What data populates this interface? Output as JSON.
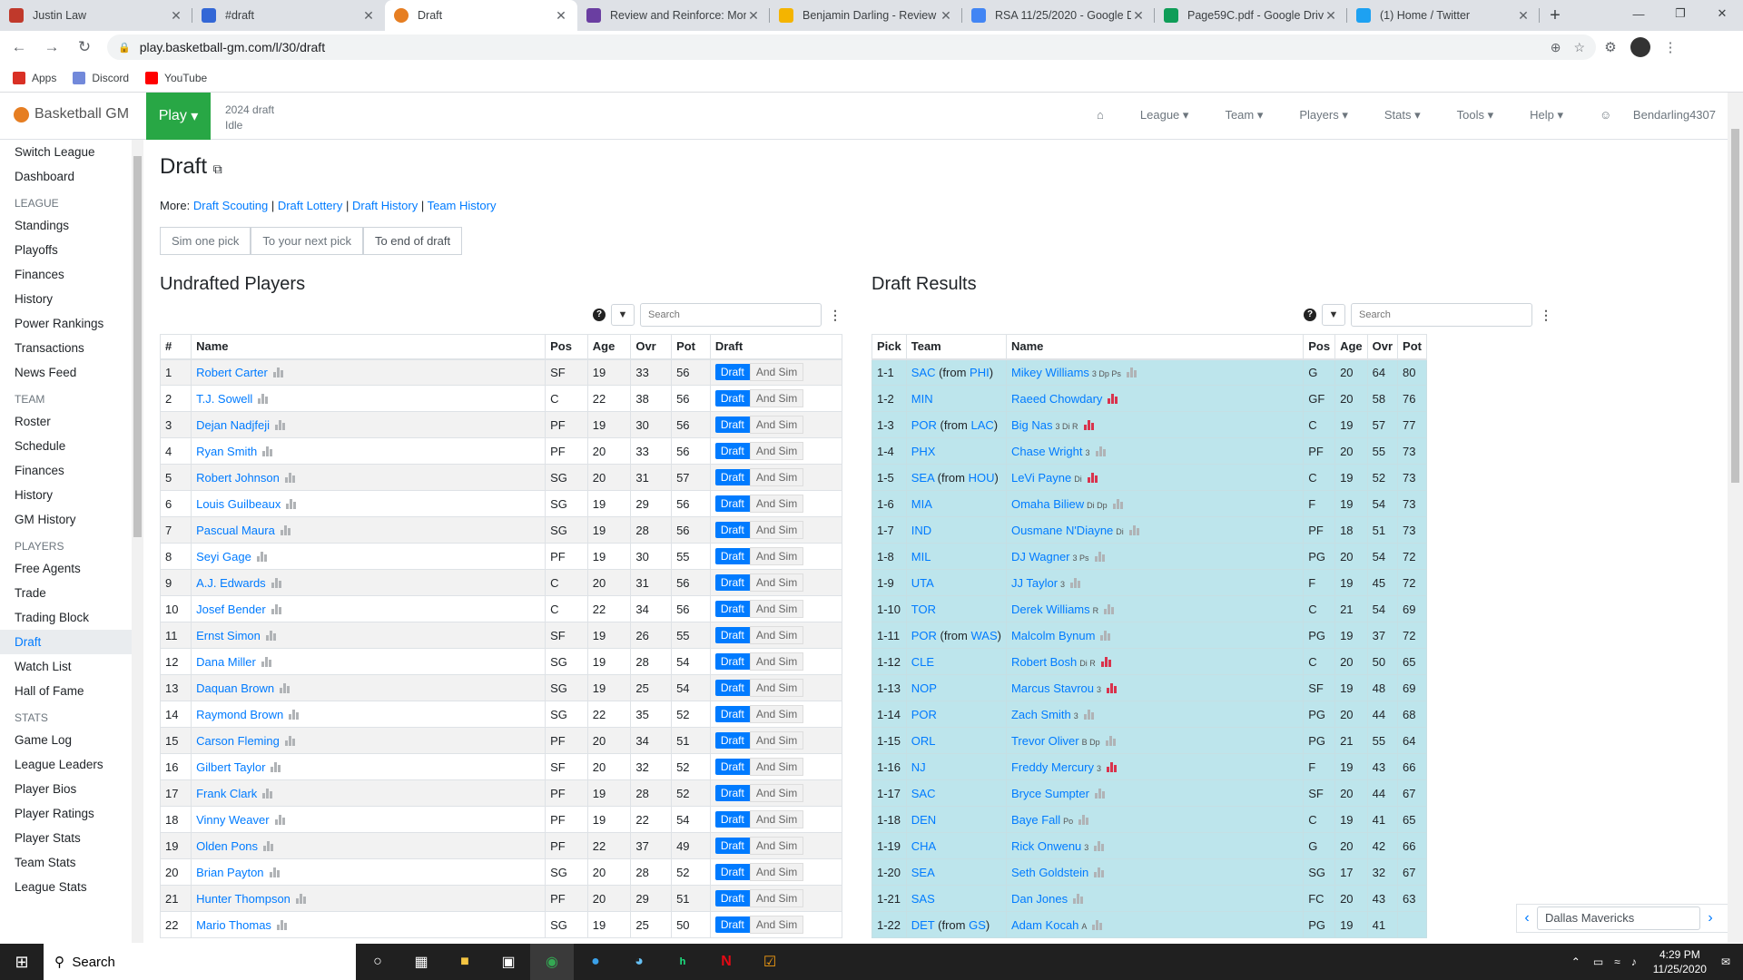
{
  "browser": {
    "tabs": [
      {
        "label": "Justin Law",
        "icon": "tab-favicon",
        "color": "#c0392b"
      },
      {
        "label": "#draft",
        "icon": "tab-favicon",
        "color": "#3367d6"
      },
      {
        "label": "Draft",
        "icon": "basketball-icon",
        "color": "#e67e22"
      },
      {
        "label": "Review and Reinforce: Mon",
        "icon": "tab-favicon",
        "color": "#6a3ea1"
      },
      {
        "label": "Benjamin Darling - Review a",
        "icon": "tab-favicon",
        "color": "#f4b400"
      },
      {
        "label": "RSA 11/25/2020 - Google D",
        "icon": "tab-favicon",
        "color": "#4285f4"
      },
      {
        "label": "Page59C.pdf - Google Drive",
        "icon": "tab-favicon",
        "color": "#0f9d58"
      },
      {
        "label": "(1) Home / Twitter",
        "icon": "tab-favicon",
        "color": "#1da1f2"
      }
    ],
    "url": "play.basketball-gm.com/l/30/draft",
    "bookmarks": [
      {
        "label": "Apps",
        "color": "#d93025"
      },
      {
        "label": "Discord",
        "color": "#7289da"
      },
      {
        "label": "YouTube",
        "color": "#ff0000"
      }
    ]
  },
  "app": {
    "brand": "Basketball GM",
    "play_label": "Play",
    "season": "2024 draft",
    "phase_status": "Idle",
    "menu": [
      "League",
      "Team",
      "Players",
      "Stats",
      "Tools",
      "Help"
    ],
    "user": "Bendarling4307"
  },
  "sidebar": {
    "top": [
      "Switch League",
      "Dashboard"
    ],
    "sections": [
      {
        "head": "LEAGUE",
        "items": [
          "Standings",
          "Playoffs",
          "Finances",
          "History",
          "Power Rankings",
          "Transactions",
          "News Feed"
        ]
      },
      {
        "head": "TEAM",
        "items": [
          "Roster",
          "Schedule",
          "Finances",
          "History",
          "GM History"
        ]
      },
      {
        "head": "PLAYERS",
        "items": [
          "Free Agents",
          "Trade",
          "Trading Block",
          "Draft",
          "Watch List",
          "Hall of Fame"
        ]
      },
      {
        "head": "STATS",
        "items": [
          "Game Log",
          "League Leaders",
          "Player Bios",
          "Player Ratings",
          "Player Stats",
          "Team Stats",
          "League Stats"
        ]
      }
    ],
    "active": "Draft"
  },
  "page": {
    "title": "Draft",
    "more_prefix": "More:",
    "more_links": [
      "Draft Scouting",
      "Draft Lottery",
      "Draft History",
      "Team History"
    ],
    "sim_buttons": [
      "Sim one pick",
      "To your next pick",
      "To end of draft"
    ],
    "undrafted_title": "Undrafted Players",
    "results_title": "Draft Results",
    "search_placeholder": "Search",
    "draft_btn": "Draft",
    "sim_btn": "And Sim"
  },
  "undrafted": {
    "columns": [
      "#",
      "Name",
      "Pos",
      "Age",
      "Ovr",
      "Pot",
      "Draft"
    ],
    "rows": [
      [
        1,
        "Robert Carter",
        "SF",
        19,
        33,
        56
      ],
      [
        2,
        "T.J. Sowell",
        "C",
        22,
        38,
        56
      ],
      [
        3,
        "Dejan Nadjfeji",
        "PF",
        19,
        30,
        56
      ],
      [
        4,
        "Ryan Smith",
        "PF",
        20,
        33,
        56
      ],
      [
        5,
        "Robert Johnson",
        "SG",
        20,
        31,
        57
      ],
      [
        6,
        "Louis Guilbeaux",
        "SG",
        19,
        29,
        56
      ],
      [
        7,
        "Pascual Maura",
        "SG",
        19,
        28,
        56
      ],
      [
        8,
        "Seyi Gage",
        "PF",
        19,
        30,
        55
      ],
      [
        9,
        "A.J. Edwards",
        "C",
        20,
        31,
        56
      ],
      [
        10,
        "Josef Bender",
        "C",
        22,
        34,
        56
      ],
      [
        11,
        "Ernst Simon",
        "SF",
        19,
        26,
        55
      ],
      [
        12,
        "Dana Miller",
        "SG",
        19,
        28,
        54
      ],
      [
        13,
        "Daquan Brown",
        "SG",
        19,
        25,
        54
      ],
      [
        14,
        "Raymond Brown",
        "SG",
        22,
        35,
        52
      ],
      [
        15,
        "Carson Fleming",
        "PF",
        20,
        34,
        51
      ],
      [
        16,
        "Gilbert Taylor",
        "SF",
        20,
        32,
        52
      ],
      [
        17,
        "Frank Clark",
        "PF",
        19,
        28,
        52
      ],
      [
        18,
        "Vinny Weaver",
        "PF",
        19,
        22,
        54
      ],
      [
        19,
        "Olden Pons",
        "PF",
        22,
        37,
        49
      ],
      [
        20,
        "Brian Payton",
        "SG",
        20,
        28,
        52
      ],
      [
        21,
        "Hunter Thompson",
        "PF",
        20,
        29,
        51
      ],
      [
        22,
        "Mario Thomas",
        "SG",
        19,
        25,
        50
      ]
    ]
  },
  "results": {
    "columns": [
      "Pick",
      "Team",
      "Name",
      "Pos",
      "Age",
      "Ovr",
      "Pot"
    ],
    "rows": [
      {
        "pick": "1-1",
        "team": "SAC",
        "from": "PHI",
        "name": "Mikey Williams",
        "tags": "3 Dp Ps",
        "red": false,
        "pos": "G",
        "age": 20,
        "ovr": 64,
        "pot": 80
      },
      {
        "pick": "1-2",
        "team": "MIN",
        "from": "",
        "name": "Raeed Chowdary",
        "tags": "",
        "red": true,
        "pos": "GF",
        "age": 20,
        "ovr": 58,
        "pot": 76
      },
      {
        "pick": "1-3",
        "team": "POR",
        "from": "LAC",
        "name": "Big Nas",
        "tags": "3 Di R",
        "red": true,
        "pos": "C",
        "age": 19,
        "ovr": 57,
        "pot": 77
      },
      {
        "pick": "1-4",
        "team": "PHX",
        "from": "",
        "name": "Chase Wright",
        "tags": "3",
        "red": false,
        "pos": "PF",
        "age": 20,
        "ovr": 55,
        "pot": 73
      },
      {
        "pick": "1-5",
        "team": "SEA",
        "from": "HOU",
        "name": "LeVi Payne",
        "tags": "Di",
        "red": true,
        "pos": "C",
        "age": 19,
        "ovr": 52,
        "pot": 73
      },
      {
        "pick": "1-6",
        "team": "MIA",
        "from": "",
        "name": "Omaha Biliew",
        "tags": "Di Dp",
        "red": false,
        "pos": "F",
        "age": 19,
        "ovr": 54,
        "pot": 73
      },
      {
        "pick": "1-7",
        "team": "IND",
        "from": "",
        "name": "Ousmane N'Diayne",
        "tags": "Di",
        "red": false,
        "pos": "PF",
        "age": 18,
        "ovr": 51,
        "pot": 73
      },
      {
        "pick": "1-8",
        "team": "MIL",
        "from": "",
        "name": "DJ Wagner",
        "tags": "3 Ps",
        "red": false,
        "pos": "PG",
        "age": 20,
        "ovr": 54,
        "pot": 72
      },
      {
        "pick": "1-9",
        "team": "UTA",
        "from": "",
        "name": "JJ Taylor",
        "tags": "3",
        "red": false,
        "pos": "F",
        "age": 19,
        "ovr": 45,
        "pot": 72
      },
      {
        "pick": "1-10",
        "team": "TOR",
        "from": "",
        "name": "Derek Williams",
        "tags": "R",
        "red": false,
        "pos": "C",
        "age": 21,
        "ovr": 54,
        "pot": 69
      },
      {
        "pick": "1-11",
        "team": "POR",
        "from": "WAS",
        "name": "Malcolm Bynum",
        "tags": "",
        "red": false,
        "pos": "PG",
        "age": 19,
        "ovr": 37,
        "pot": 72
      },
      {
        "pick": "1-12",
        "team": "CLE",
        "from": "",
        "name": "Robert Bosh",
        "tags": "Di R",
        "red": true,
        "pos": "C",
        "age": 20,
        "ovr": 50,
        "pot": 65
      },
      {
        "pick": "1-13",
        "team": "NOP",
        "from": "",
        "name": "Marcus Stavrou",
        "tags": "3",
        "red": true,
        "pos": "SF",
        "age": 19,
        "ovr": 48,
        "pot": 69
      },
      {
        "pick": "1-14",
        "team": "POR",
        "from": "",
        "name": "Zach Smith",
        "tags": "3",
        "red": false,
        "pos": "PG",
        "age": 20,
        "ovr": 44,
        "pot": 68
      },
      {
        "pick": "1-15",
        "team": "ORL",
        "from": "",
        "name": "Trevor Oliver",
        "tags": "B Dp",
        "red": false,
        "pos": "PG",
        "age": 21,
        "ovr": 55,
        "pot": 64
      },
      {
        "pick": "1-16",
        "team": "NJ",
        "from": "",
        "name": "Freddy Mercury",
        "tags": "3",
        "red": true,
        "pos": "F",
        "age": 19,
        "ovr": 43,
        "pot": 66
      },
      {
        "pick": "1-17",
        "team": "SAC",
        "from": "",
        "name": "Bryce Sumpter",
        "tags": "",
        "red": false,
        "pos": "SF",
        "age": 20,
        "ovr": 44,
        "pot": 67
      },
      {
        "pick": "1-18",
        "team": "DEN",
        "from": "",
        "name": "Baye Fall",
        "tags": "Po",
        "red": false,
        "pos": "C",
        "age": 19,
        "ovr": 41,
        "pot": 65
      },
      {
        "pick": "1-19",
        "team": "CHA",
        "from": "",
        "name": "Rick Onwenu",
        "tags": "3",
        "red": false,
        "pos": "G",
        "age": 20,
        "ovr": 42,
        "pot": 66
      },
      {
        "pick": "1-20",
        "team": "SEA",
        "from": "",
        "name": "Seth Goldstein",
        "tags": "",
        "red": false,
        "pos": "SG",
        "age": 17,
        "ovr": 32,
        "pot": 67
      },
      {
        "pick": "1-21",
        "team": "SAS",
        "from": "",
        "name": "Dan Jones",
        "tags": "",
        "red": false,
        "pos": "FC",
        "age": 20,
        "ovr": 43,
        "pot": 63
      },
      {
        "pick": "1-22",
        "team": "DET",
        "from": "GS",
        "name": "Adam Kocah",
        "tags": "A",
        "red": false,
        "pos": "PG",
        "age": 19,
        "ovr": 41,
        "pot": ""
      }
    ]
  },
  "team_select": "Dallas Mavericks",
  "taskbar": {
    "search": "Search",
    "time": "4:29 PM",
    "date": "11/25/2020"
  }
}
